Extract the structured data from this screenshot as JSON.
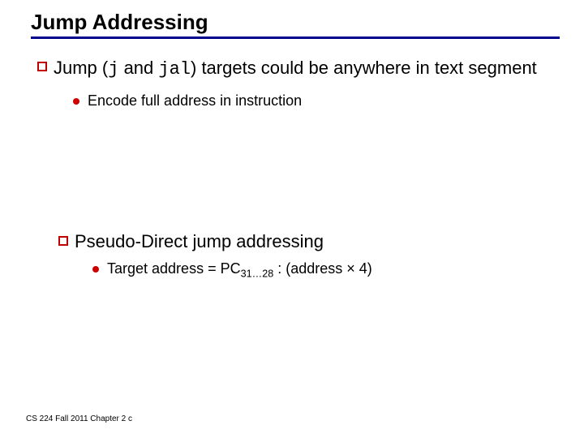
{
  "title": "Jump Addressing",
  "bullet1_pre": "Jump (",
  "bullet1_code1": "j",
  "bullet1_mid": " and ",
  "bullet1_code2": "jal",
  "bullet1_post": ") targets could be anywhere in text segment",
  "sub1": "Encode full address in instruction",
  "bullet2": "Pseudo-Direct jump addressing",
  "sub2_pre": "Target address = PC",
  "sub2_subscript": "31…28",
  "sub2_post": " : (address × 4)",
  "footer": "CS 224 Fall 2011 Chapter 2 c"
}
